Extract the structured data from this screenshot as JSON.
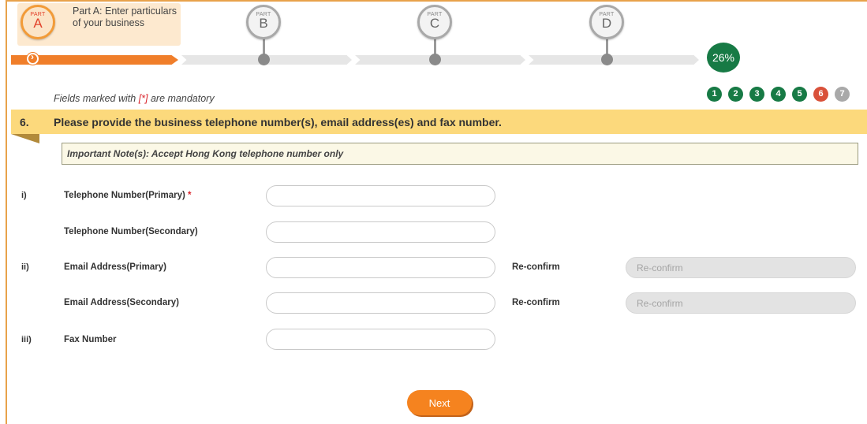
{
  "progress": {
    "parts": [
      {
        "word": "PART",
        "letter": "A"
      },
      {
        "word": "PART",
        "letter": "B"
      },
      {
        "word": "PART",
        "letter": "C"
      },
      {
        "word": "PART",
        "letter": "D"
      }
    ],
    "active_description": "Part A: Enter particulars of your business",
    "percent_text": "26%",
    "percent_value": 26,
    "steps": [
      "1",
      "2",
      "3",
      "4",
      "5",
      "6",
      "7"
    ],
    "current_step": "6"
  },
  "mandatory": {
    "prefix": "Fields marked with ",
    "marker": "[*]",
    "suffix": " are mandatory"
  },
  "section": {
    "number": "6.",
    "title": "Please provide the business telephone number(s), email address(es) and fax number.",
    "note": "Important Note(s): Accept Hong Kong telephone number only"
  },
  "form": {
    "rows": [
      {
        "index": "i)",
        "label": "Telephone Number(Primary)",
        "required": "*",
        "value": ""
      },
      {
        "index": "",
        "label": "Telephone Number(Secondary)",
        "value": ""
      },
      {
        "index": "ii)",
        "label": "Email Address(Primary)",
        "value": "",
        "reconfirm_label": "Re-confirm",
        "reconfirm_placeholder": "Re-confirm"
      },
      {
        "index": "",
        "label": "Email Address(Secondary)",
        "value": "",
        "reconfirm_label": "Re-confirm",
        "reconfirm_placeholder": "Re-confirm"
      },
      {
        "index": "iii)",
        "label": "Fax Number",
        "value": ""
      }
    ],
    "next_label": "Next"
  },
  "colors": {
    "accent": "#f5831f",
    "progress_done": "#f07e2a",
    "step_done": "#177a45",
    "step_current": "#d9513a",
    "section_bar": "#fcd97c"
  }
}
